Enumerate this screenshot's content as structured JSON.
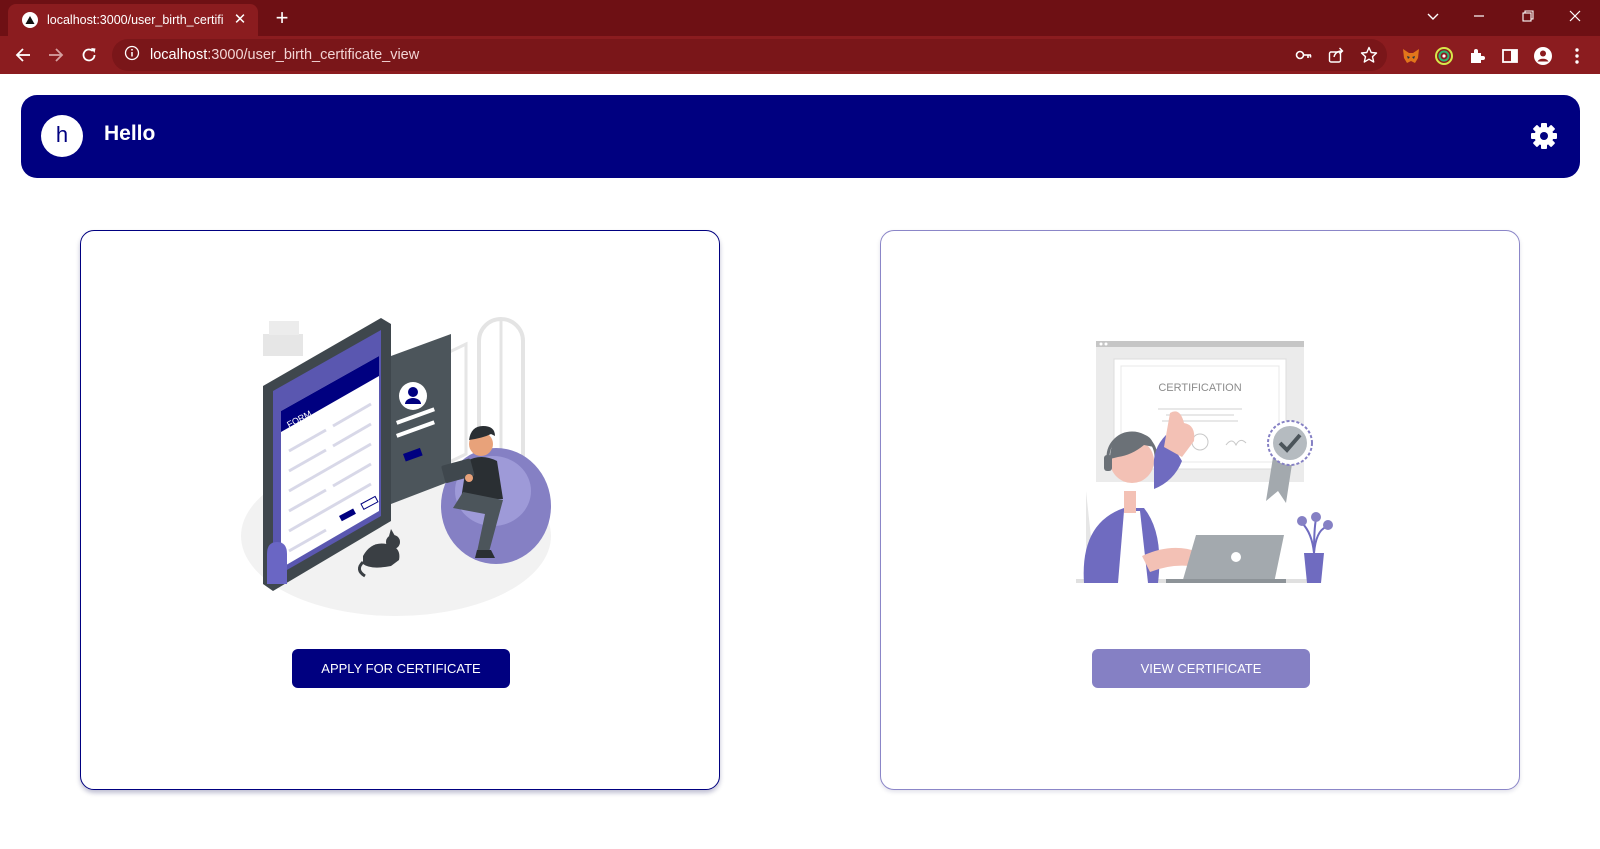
{
  "browser": {
    "tab_title": "localhost:3000/user_birth_certific",
    "tab_close": "✕",
    "new_tab": "+",
    "url_host": "localhost",
    "url_path": ":3000/user_birth_certificate_view"
  },
  "app": {
    "avatar_letter": "h",
    "greeting": "Hello",
    "header_color": "#000080"
  },
  "cards": [
    {
      "illustration": "form-illustration",
      "button_label": "APPLY FOR CERTIFICATE",
      "button_color": "#000080"
    },
    {
      "illustration": "certificate-illustration",
      "certificate_heading": "CERTIFICATION",
      "button_label": "VIEW CERTIFICATE",
      "button_color": "#8580c4"
    }
  ],
  "icons": [
    "back-icon",
    "forward-icon",
    "reload-icon",
    "info-icon",
    "key-icon",
    "share-icon",
    "star-icon",
    "metamask-icon",
    "extension-icon",
    "puzzle-icon",
    "sidepanel-icon",
    "profile-icon",
    "menu-icon",
    "settings-gear-icon"
  ]
}
